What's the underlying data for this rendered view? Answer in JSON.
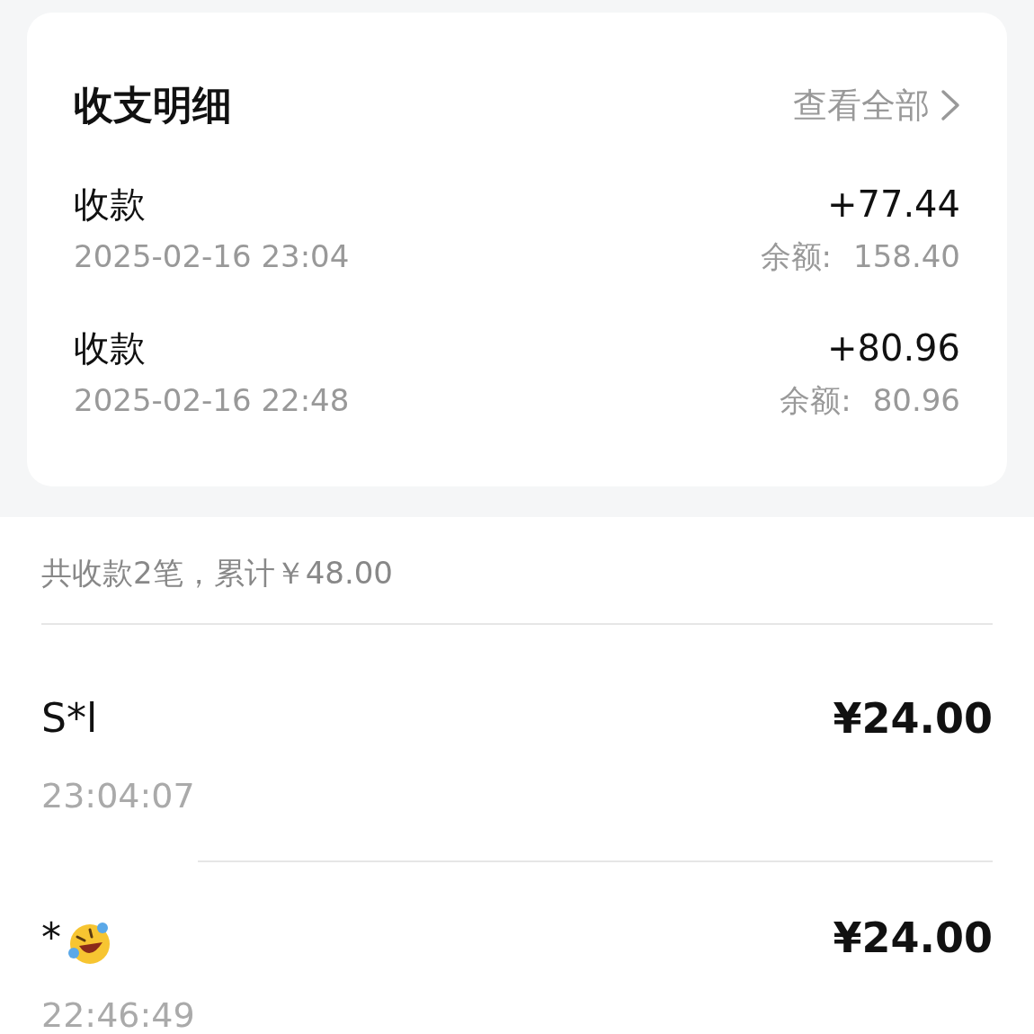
{
  "card": {
    "title": "收支明细",
    "view_all": "查看全部",
    "items": [
      {
        "label": "收款",
        "time": "2025-02-16 23:04",
        "amount": "+77.44",
        "balance_label": "余额:",
        "balance": "158.40"
      },
      {
        "label": "收款",
        "time": "2025-02-16 22:48",
        "amount": "+80.96",
        "balance_label": "余额:",
        "balance": "80.96"
      }
    ]
  },
  "summary": "共收款2笔，累计￥48.00",
  "payments": [
    {
      "name": "S*l",
      "kind": "plain",
      "amount": "¥24.00",
      "time": "23:04:07"
    },
    {
      "name": "*",
      "kind": "emoji",
      "amount": "¥24.00",
      "time": "22:46:49"
    }
  ]
}
